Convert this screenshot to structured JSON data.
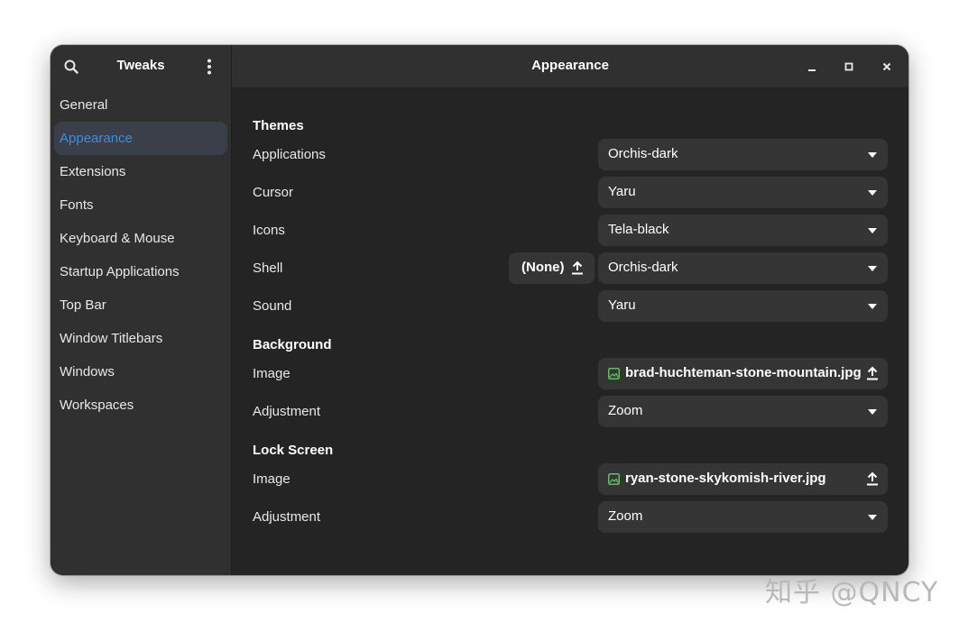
{
  "sidebar": {
    "title": "Tweaks",
    "items": [
      {
        "label": "General"
      },
      {
        "label": "Appearance"
      },
      {
        "label": "Extensions"
      },
      {
        "label": "Fonts"
      },
      {
        "label": "Keyboard & Mouse"
      },
      {
        "label": "Startup Applications"
      },
      {
        "label": "Top Bar"
      },
      {
        "label": "Window Titlebars"
      },
      {
        "label": "Windows"
      },
      {
        "label": "Workspaces"
      }
    ],
    "active_item": "Appearance",
    "icons": [
      "search-icon",
      "kebab-menu-icon"
    ]
  },
  "header": {
    "title": "Appearance",
    "window_buttons": [
      "minimize-icon",
      "maximize-icon",
      "close-icon"
    ]
  },
  "themes": {
    "title": "Themes",
    "applications": {
      "label": "Applications",
      "value": "Orchis-dark"
    },
    "cursor": {
      "label": "Cursor",
      "value": "Yaru"
    },
    "icons": {
      "label": "Icons",
      "value": "Tela-black"
    },
    "shell": {
      "label": "Shell",
      "file_button": "(None)",
      "value": "Orchis-dark"
    },
    "sound": {
      "label": "Sound",
      "value": "Yaru"
    }
  },
  "background": {
    "title": "Background",
    "image": {
      "label": "Image",
      "file": "brad-huchteman-stone-mountain.jpg"
    },
    "adjustment": {
      "label": "Adjustment",
      "value": "Zoom"
    }
  },
  "lock_screen": {
    "title": "Lock Screen",
    "image": {
      "label": "Image",
      "file": "ryan-stone-skykomish-river.jpg"
    },
    "adjustment": {
      "label": "Adjustment",
      "value": "Zoom"
    }
  },
  "watermark": {
    "text": "知乎 @QNCY"
  },
  "colors": {
    "accent": "#3d8ee0",
    "window_bg": "#242424",
    "sidebar_bg": "#303030",
    "widget_bg": "#353535",
    "image_icon": "#5fbf5f"
  }
}
